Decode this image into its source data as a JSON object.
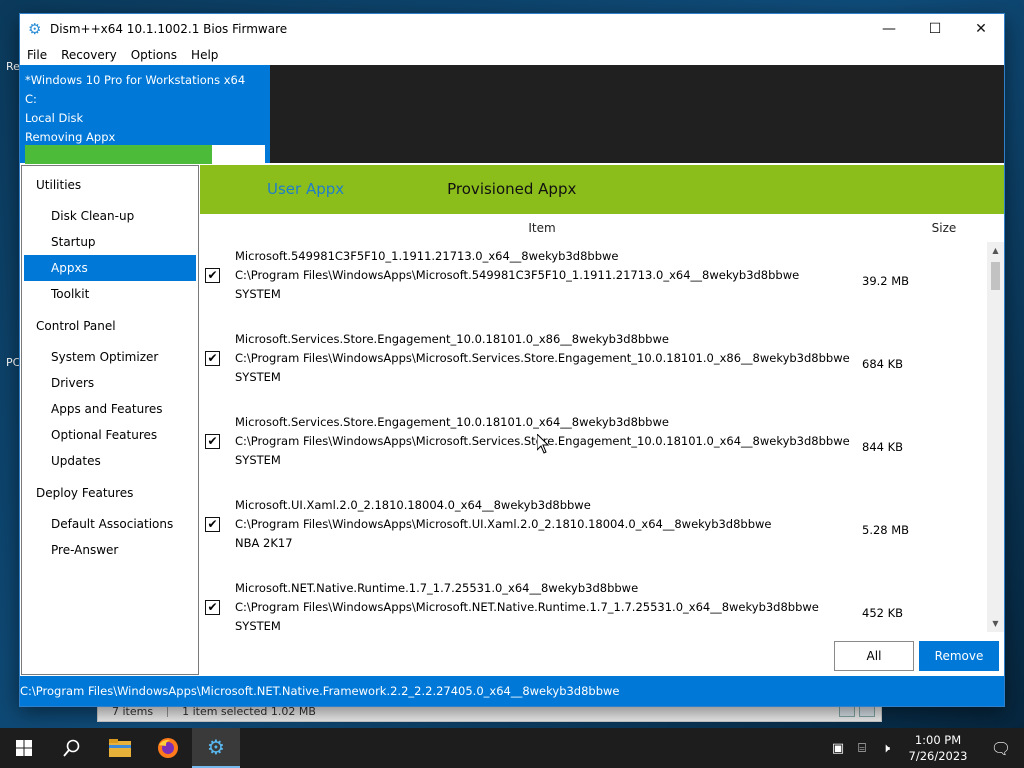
{
  "window": {
    "title": "Dism++x64 10.1.1002.1 Bios Firmware",
    "minimize": "—",
    "maximize": "☐",
    "close": "✕"
  },
  "menu": [
    "File",
    "Recovery",
    "Options",
    "Help"
  ],
  "session": {
    "os": "*Windows 10 Pro for Workstations x64",
    "drive": "C:",
    "disk": "Local Disk",
    "operation": "Removing Appx",
    "progress": 0.78
  },
  "sidebar": {
    "groups": [
      {
        "label": "Utilities",
        "items": [
          "Disk Clean-up",
          "Startup",
          "Appxs",
          "Toolkit"
        ]
      },
      {
        "label": "Control Panel",
        "items": [
          "System Optimizer",
          "Drivers",
          "Apps and Features",
          "Optional Features",
          "Updates"
        ]
      },
      {
        "label": "Deploy Features",
        "items": [
          "Default Associations",
          "Pre-Answer"
        ]
      }
    ],
    "active": "Appxs"
  },
  "tabs": {
    "user": "User Appx",
    "provisioned": "Provisioned Appx"
  },
  "columns": {
    "item": "Item",
    "size": "Size"
  },
  "rows": [
    {
      "name": "Microsoft.549981C3F5F10_1.1911.21713.0_x64__8wekyb3d8bbwe",
      "path": "C:\\Program Files\\WindowsApps\\Microsoft.549981C3F5F10_1.1911.21713.0_x64__8wekyb3d8bbwe",
      "owner": "SYSTEM",
      "size": "39.2 MB",
      "checked": "✔"
    },
    {
      "name": "Microsoft.Services.Store.Engagement_10.0.18101.0_x86__8wekyb3d8bbwe",
      "path": "C:\\Program Files\\WindowsApps\\Microsoft.Services.Store.Engagement_10.0.18101.0_x86__8wekyb3d8bbwe",
      "owner": "SYSTEM",
      "size": "684 KB",
      "checked": "✔"
    },
    {
      "name": "Microsoft.Services.Store.Engagement_10.0.18101.0_x64__8wekyb3d8bbwe",
      "path": "C:\\Program Files\\WindowsApps\\Microsoft.Services.Store.Engagement_10.0.18101.0_x64__8wekyb3d8bbwe",
      "owner": "SYSTEM",
      "size": "844 KB",
      "checked": "✔"
    },
    {
      "name": "Microsoft.UI.Xaml.2.0_2.1810.18004.0_x64__8wekyb3d8bbwe",
      "path": "C:\\Program Files\\WindowsApps\\Microsoft.UI.Xaml.2.0_2.1810.18004.0_x64__8wekyb3d8bbwe",
      "owner": "NBA 2K17",
      "size": "5.28 MB",
      "checked": "✔"
    },
    {
      "name": "Microsoft.NET.Native.Runtime.1.7_1.7.25531.0_x64__8wekyb3d8bbwe",
      "path": "C:\\Program Files\\WindowsApps\\Microsoft.NET.Native.Runtime.1.7_1.7.25531.0_x64__8wekyb3d8bbwe",
      "owner": "SYSTEM",
      "size": "452 KB",
      "checked": "✔"
    }
  ],
  "buttons": {
    "all": "All",
    "remove": "Remove"
  },
  "status": "C:\\Program Files\\WindowsApps\\Microsoft.NET.Native.Framework.2.2_2.2.27405.0_x64__8wekyb3d8bbwe",
  "explorer": {
    "items": "7 items",
    "selected": "1 item selected  1.02 MB"
  },
  "taskbar": {
    "time": "1:00 PM",
    "date": "7/26/2023"
  },
  "colors": {
    "accent": "#0078d7",
    "tabs": "#8cbe1b",
    "progress": "#4cbb3a"
  }
}
